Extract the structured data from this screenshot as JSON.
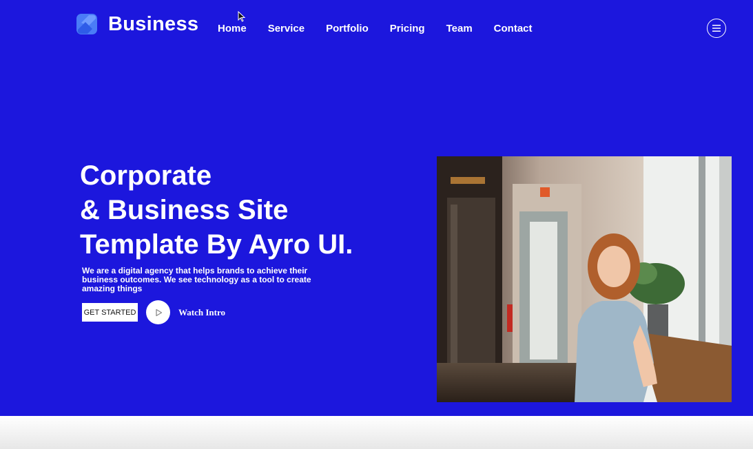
{
  "brand": {
    "name": "Business",
    "logo_icon": "s-logo-icon",
    "color": "#1c17dd"
  },
  "nav": {
    "items": [
      {
        "label": "Home"
      },
      {
        "label": "Service"
      },
      {
        "label": "Portfolio"
      },
      {
        "label": "Pricing"
      },
      {
        "label": "Team"
      },
      {
        "label": "Contact"
      }
    ],
    "menu_icon": "hamburger-icon"
  },
  "hero": {
    "headline_lines": [
      "Corporate",
      "& Business Site",
      "Template By Ayro UI."
    ],
    "description": "We are a digital agency that helps brands to achieve their business outcomes. We see technology as a tool to create amazing things",
    "cta_label": "GET STARTED",
    "watch_label": "Watch Intro",
    "play_icon": "play-icon",
    "image": "smiling-woman-in-office-photo"
  }
}
